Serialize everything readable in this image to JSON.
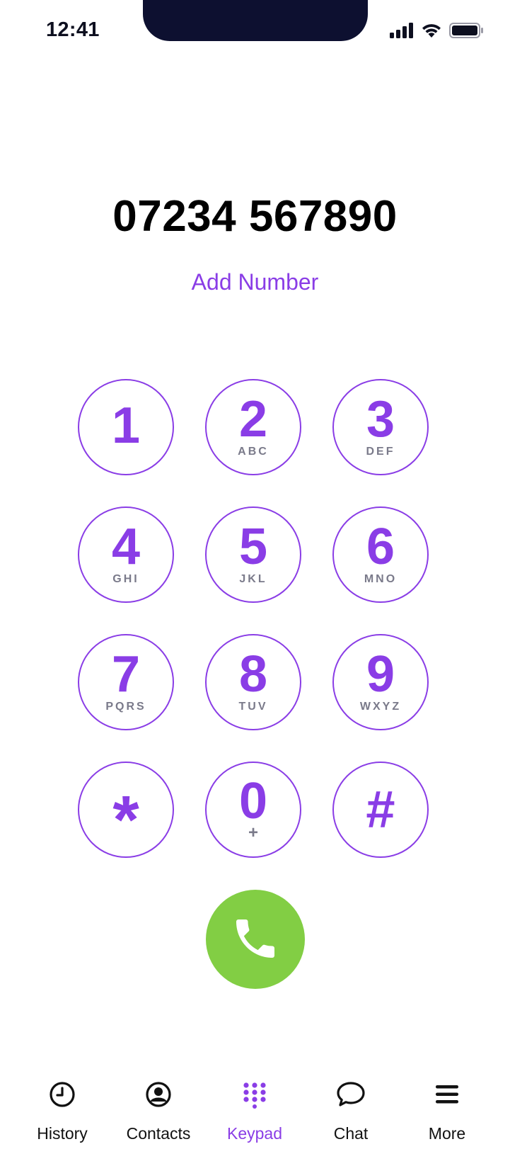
{
  "status_bar": {
    "time": "12:41",
    "icons": [
      "cellular-signal-icon",
      "wifi-icon",
      "battery-icon"
    ]
  },
  "dialer": {
    "number": "07234 567890",
    "add_number_label": "Add Number"
  },
  "keypad": {
    "keys": [
      {
        "digit": "1",
        "letters": ""
      },
      {
        "digit": "2",
        "letters": "ABC"
      },
      {
        "digit": "3",
        "letters": "DEF"
      },
      {
        "digit": "4",
        "letters": "GHI"
      },
      {
        "digit": "5",
        "letters": "JKL"
      },
      {
        "digit": "6",
        "letters": "MNO"
      },
      {
        "digit": "7",
        "letters": "PQRS"
      },
      {
        "digit": "8",
        "letters": "TUV"
      },
      {
        "digit": "9",
        "letters": "WXYZ"
      },
      {
        "digit": "*",
        "letters": ""
      },
      {
        "digit": "0",
        "letters": "+"
      },
      {
        "digit": "#",
        "letters": ""
      }
    ]
  },
  "call_button": {
    "icon": "phone-icon",
    "color": "#82ce44"
  },
  "tab_bar": {
    "active": "Keypad",
    "items": [
      {
        "label": "History",
        "icon": "clock-icon"
      },
      {
        "label": "Contacts",
        "icon": "user-circle-icon"
      },
      {
        "label": "Keypad",
        "icon": "keypad-grid-icon"
      },
      {
        "label": "Chat",
        "icon": "chat-bubble-icon"
      },
      {
        "label": "More",
        "icon": "menu-icon"
      }
    ]
  },
  "colors": {
    "accent": "#8a3de6",
    "call_green": "#82ce44",
    "secondary_text": "#7a7a8a"
  }
}
